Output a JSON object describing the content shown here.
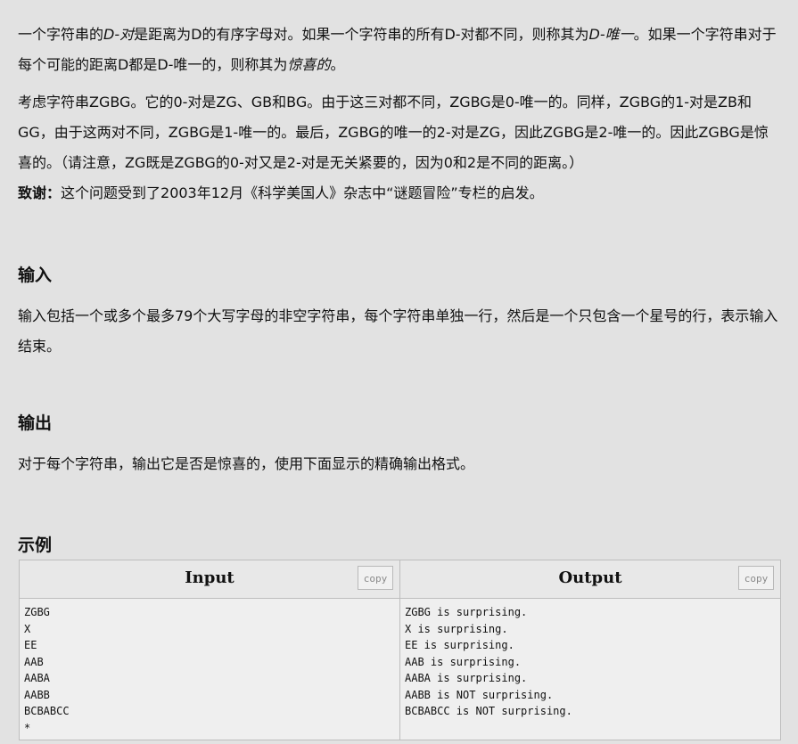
{
  "intro": {
    "p1": [
      {
        "t": "一个字符串的",
        "s": "n"
      },
      {
        "t": "D-对",
        "s": "i"
      },
      {
        "t": "是距离为D的有序字母对。如果一个字符串的所有D-对都不同，则称其为",
        "s": "n"
      },
      {
        "t": "D-唯一",
        "s": "i"
      },
      {
        "t": "。如果一个字符串对于每个可能的距离D都是D-唯一的，则称其为",
        "s": "n"
      },
      {
        "t": "惊喜的",
        "s": "i"
      },
      {
        "t": "。",
        "s": "n"
      }
    ],
    "p2": "考虑字符串ZGBG。它的0-对是ZG、GB和BG。由于这三对都不同，ZGBG是0-唯一的。同样，ZGBG的1-对是ZB和GG，由于这两对不同，ZGBG是1-唯一的。最后，ZGBG的唯一的2-对是ZG，因此ZGBG是2-唯一的。因此ZGBG是惊喜的。（请注意，ZG既是ZGBG的0-对又是2-对是无关紧要的，因为0和2是不同的距离。）",
    "credit_label": "致谢：",
    "credit_text": "这个问题受到了2003年12月《科学美国人》杂志中“谜题冒险”专栏的启发。"
  },
  "sections": {
    "input_title": "输入",
    "input_text": "输入包括一个或多个最多79个大写字母的非空字符串，每个字符串单独一行，然后是一个只包含一个星号的行，表示输入结束。",
    "output_title": "输出",
    "output_text": "对于每个字符串，输出它是否是惊喜的，使用下面显示的精确输出格式。",
    "example_title": "示例"
  },
  "sample": {
    "input_header": "Input",
    "output_header": "Output",
    "copy_label": "copy",
    "input_lines": [
      "ZGBG",
      "X",
      "EE",
      "AAB",
      "AABA",
      "AABB",
      "BCBABCC",
      "*"
    ],
    "output_lines": [
      "ZGBG is surprising.",
      "X is surprising.",
      "EE is surprising.",
      "AAB is surprising.",
      "AABA is surprising.",
      "AABB is NOT surprising.",
      "BCBABCC is NOT surprising."
    ]
  }
}
